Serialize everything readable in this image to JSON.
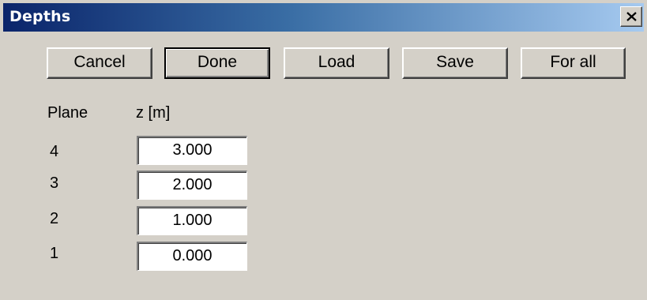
{
  "window": {
    "title": "Depths",
    "close_label": "×"
  },
  "toolbar": {
    "cancel_label": "Cancel",
    "done_label": "Done",
    "load_label": "Load",
    "save_label": "Save",
    "for_all_label": "For all"
  },
  "table": {
    "headers": {
      "plane": "Plane",
      "z": "z [m]"
    },
    "rows": [
      {
        "plane": "4",
        "z": "3.000"
      },
      {
        "plane": "3",
        "z": "2.000"
      },
      {
        "plane": "2",
        "z": "1.000"
      },
      {
        "plane": "1",
        "z": "0.000"
      }
    ]
  },
  "colors": {
    "dialog_bg": "#d4d0c8",
    "titlebar_start": "#0a246a",
    "titlebar_end": "#a6caf0",
    "title_text": "#ffffff"
  }
}
